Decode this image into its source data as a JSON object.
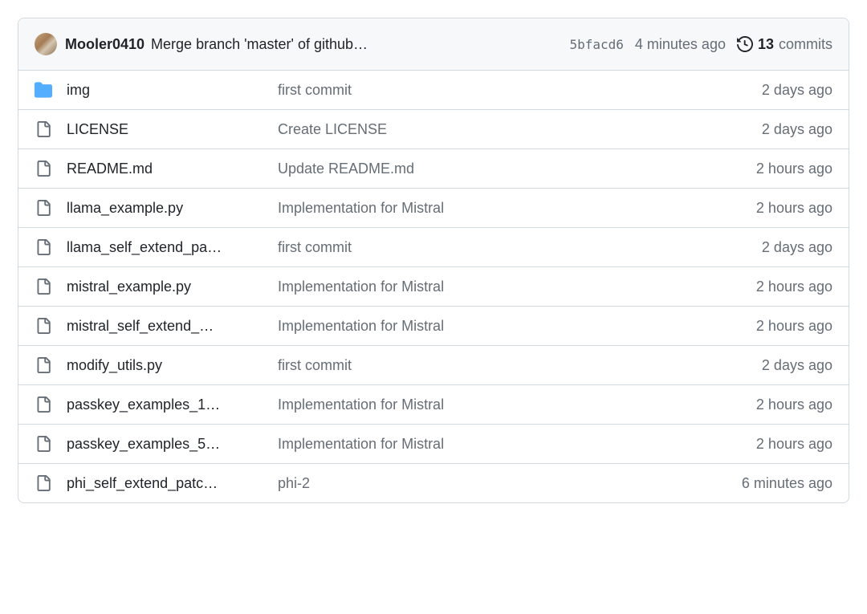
{
  "header": {
    "author": "Mooler0410",
    "commit_message": "Merge branch 'master' of github",
    "sha": "5bfacd6",
    "relative_time": "4 minutes ago",
    "commit_count": "13",
    "commits_label": "commits"
  },
  "rows": [
    {
      "type": "dir",
      "name": "img",
      "truncated": false,
      "message": "first commit",
      "time": "2 days ago"
    },
    {
      "type": "file",
      "name": "LICENSE",
      "truncated": false,
      "message": "Create LICENSE",
      "time": "2 days ago"
    },
    {
      "type": "file",
      "name": "README.md",
      "truncated": false,
      "message": "Update README.md",
      "time": "2 hours ago"
    },
    {
      "type": "file",
      "name": "llama_example.py",
      "truncated": false,
      "message": "Implementation for Mistral",
      "time": "2 hours ago"
    },
    {
      "type": "file",
      "name": "llama_self_extend_pa",
      "truncated": true,
      "message": "first commit",
      "time": "2 days ago"
    },
    {
      "type": "file",
      "name": "mistral_example.py",
      "truncated": false,
      "message": "Implementation for Mistral",
      "time": "2 hours ago"
    },
    {
      "type": "file",
      "name": "mistral_self_extend_",
      "truncated": true,
      "message": "Implementation for Mistral",
      "time": "2 hours ago"
    },
    {
      "type": "file",
      "name": "modify_utils.py",
      "truncated": false,
      "message": "first commit",
      "time": "2 days ago"
    },
    {
      "type": "file",
      "name": "passkey_examples_1",
      "truncated": true,
      "message": "Implementation for Mistral",
      "time": "2 hours ago"
    },
    {
      "type": "file",
      "name": "passkey_examples_5",
      "truncated": true,
      "message": "Implementation for Mistral",
      "time": "2 hours ago"
    },
    {
      "type": "file",
      "name": "phi_self_extend_patc",
      "truncated": true,
      "message": "phi-2",
      "time": "6 minutes ago"
    }
  ]
}
